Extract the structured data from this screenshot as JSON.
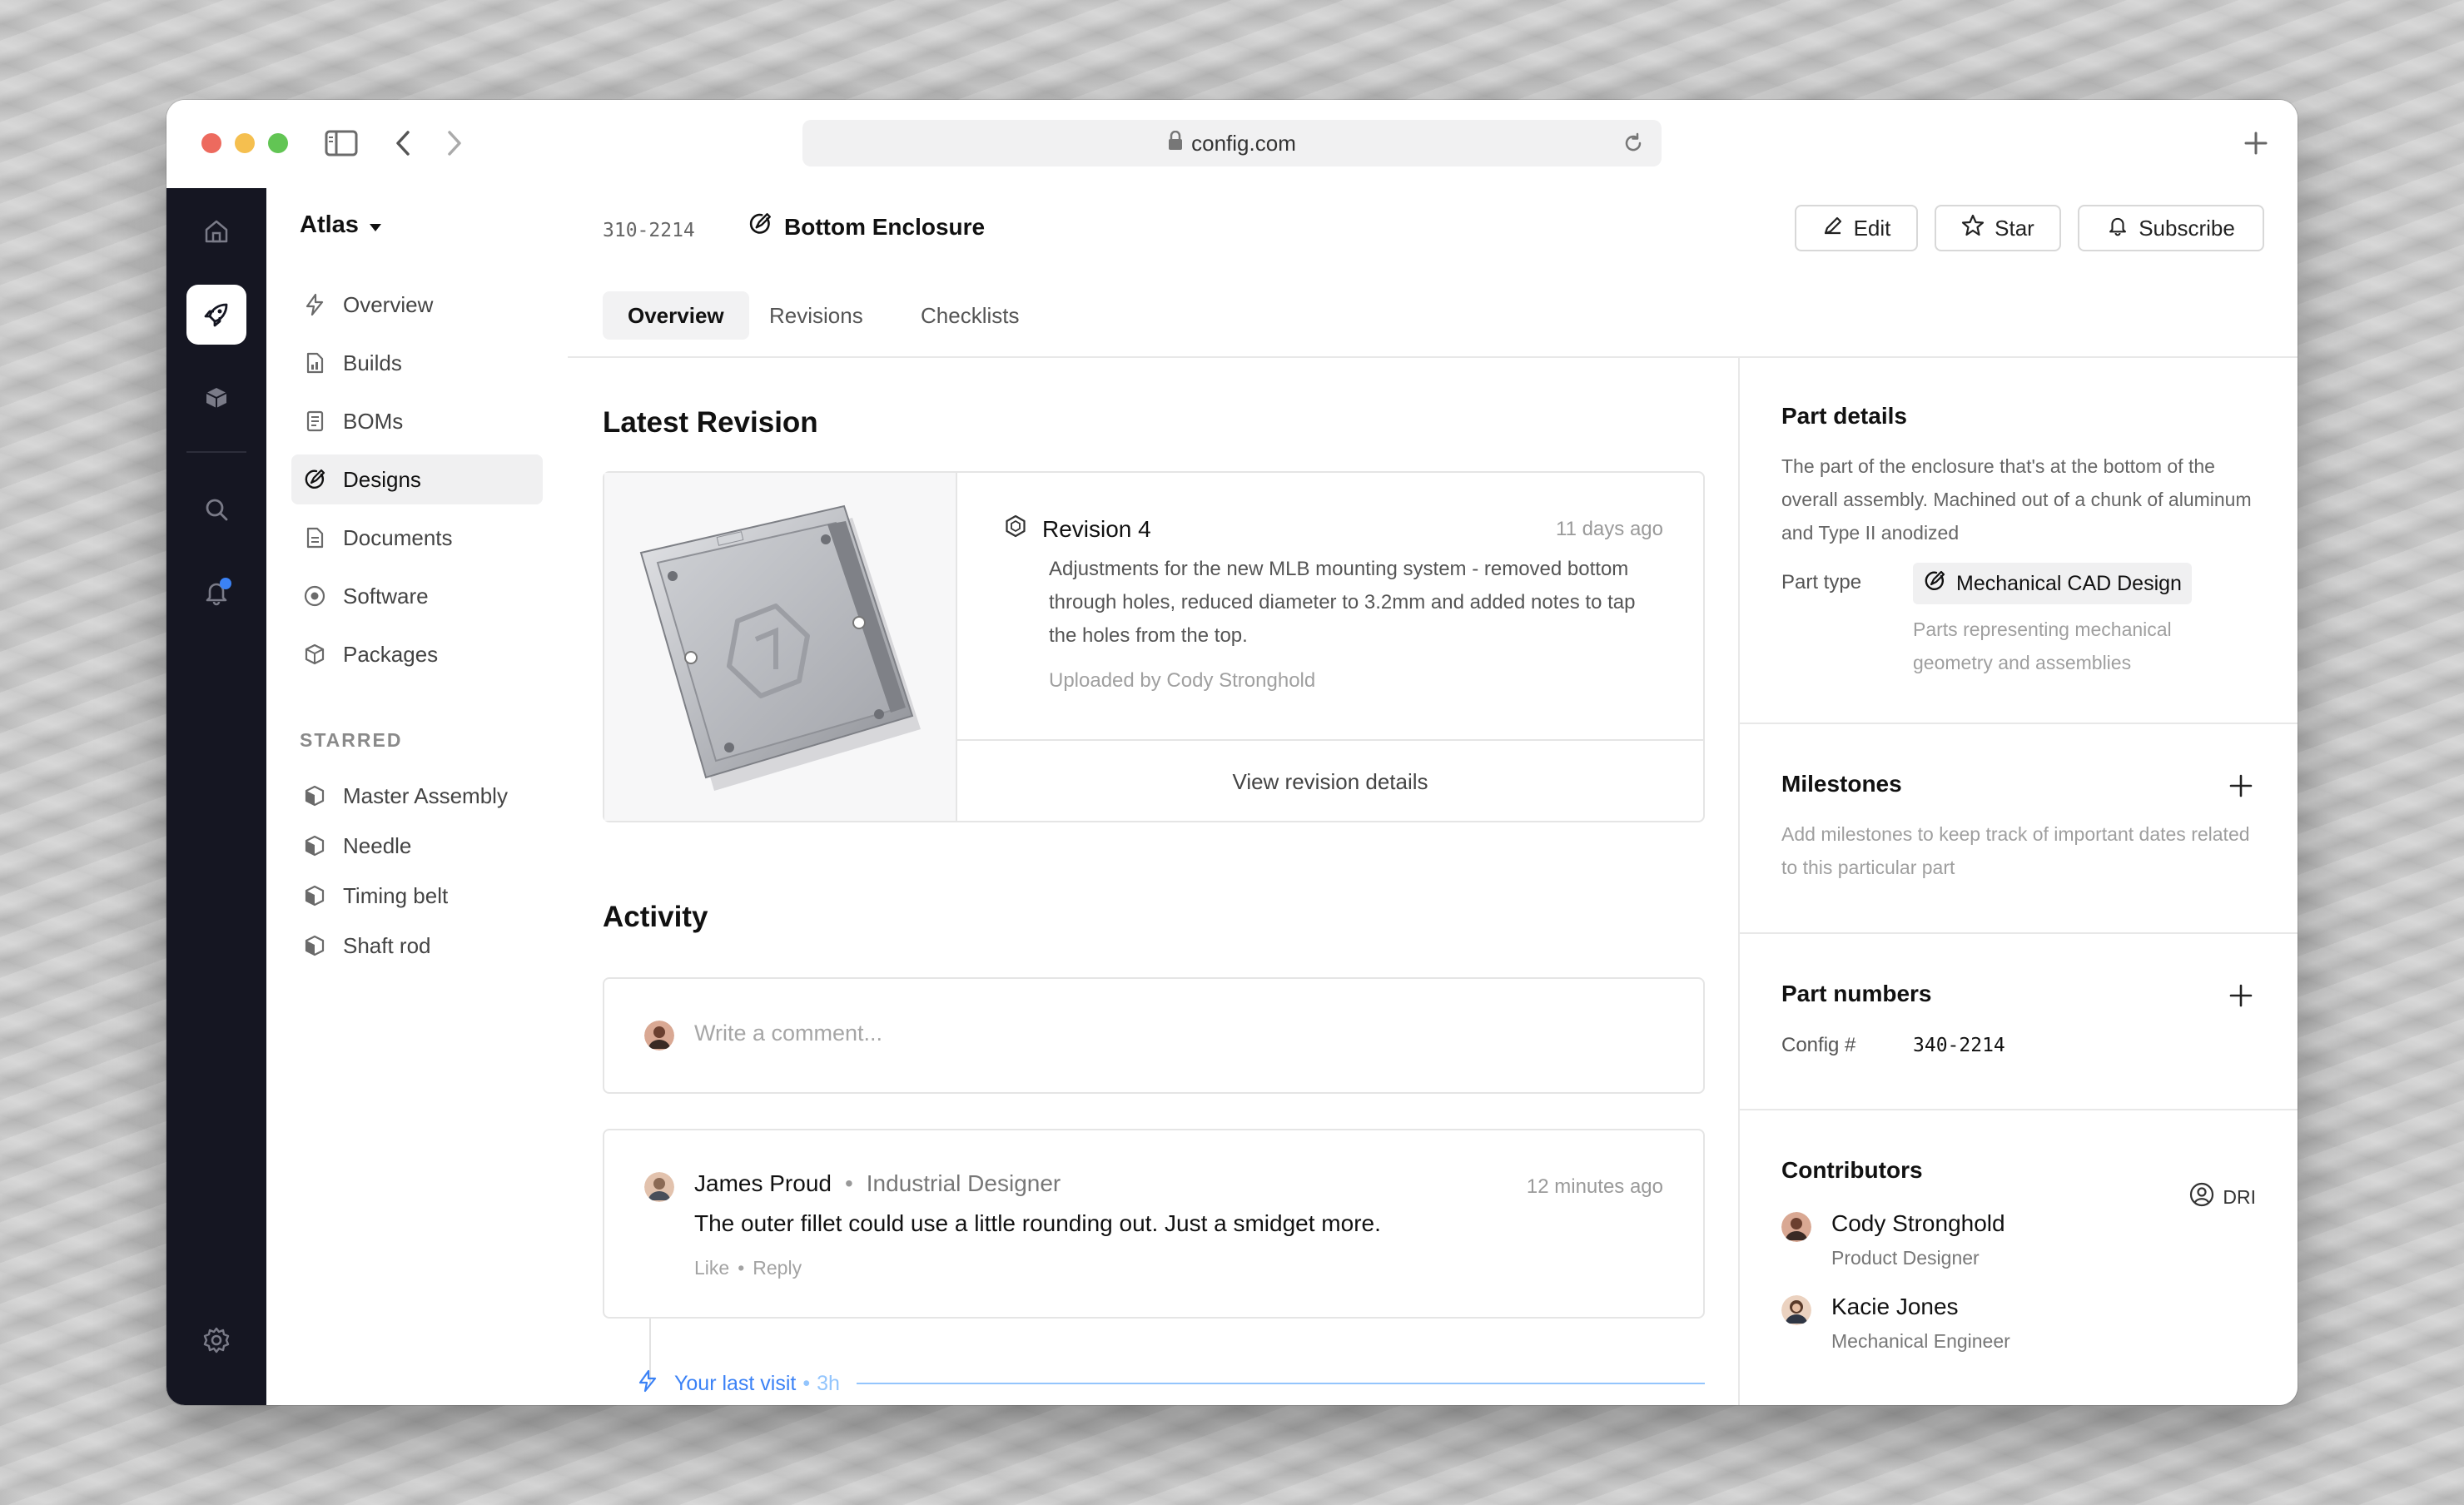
{
  "browser": {
    "url": "config.com"
  },
  "workspace": {
    "name": "Atlas"
  },
  "nav": {
    "items": [
      {
        "label": "Overview",
        "icon": "bolt-icon"
      },
      {
        "label": "Builds",
        "icon": "builds-icon"
      },
      {
        "label": "BOMs",
        "icon": "bom-icon"
      },
      {
        "label": "Designs",
        "icon": "design-icon",
        "active": true
      },
      {
        "label": "Documents",
        "icon": "document-icon"
      },
      {
        "label": "Software",
        "icon": "software-icon"
      },
      {
        "label": "Packages",
        "icon": "package-icon"
      }
    ],
    "starred_label": "STARRED",
    "starred": [
      {
        "label": "Master Assembly"
      },
      {
        "label": "Needle"
      },
      {
        "label": "Timing belt"
      },
      {
        "label": "Shaft rod"
      }
    ]
  },
  "header": {
    "part_number": "310-2214",
    "title": "Bottom Enclosure",
    "edit_label": "Edit",
    "star_label": "Star",
    "subscribe_label": "Subscribe"
  },
  "tabs": [
    {
      "label": "Overview",
      "active": true
    },
    {
      "label": "Revisions"
    },
    {
      "label": "Checklists"
    }
  ],
  "latest_revision": {
    "heading": "Latest Revision",
    "title": "Revision 4",
    "time": "11 days ago",
    "description": "Adjustments for the new MLB mounting system - removed bottom through holes, reduced diameter to 3.2mm and added notes to tap the holes from the top.",
    "uploaded_by": "Uploaded by Cody Stronghold",
    "view_label": "View revision details"
  },
  "activity": {
    "heading": "Activity",
    "comment_placeholder": "Write a comment...",
    "post": {
      "author": "James Proud",
      "role": "Industrial Designer",
      "time": "12  minutes ago",
      "text": "The outer fillet could use a little rounding out. Just a smidget more.",
      "like_label": "Like",
      "reply_label": "Reply"
    },
    "last_visit_label": "Your last visit",
    "last_visit_time": "3h"
  },
  "part_details": {
    "heading": "Part details",
    "description": "The part of the enclosure that's at the bottom of the overall assembly. Machined out of a chunk of aluminum and Type II anodized",
    "type_label": "Part type",
    "type_value": "Mechanical CAD Design",
    "type_hint": "Parts representing mechanical geometry and assemblies"
  },
  "milestones": {
    "heading": "Milestones",
    "hint": "Add milestones to keep track of important dates related to this particular part"
  },
  "part_numbers": {
    "heading": "Part numbers",
    "label": "Config #",
    "value": "340-2214"
  },
  "contributors": {
    "heading": "Contributors",
    "people": [
      {
        "name": "Cody Stronghold",
        "role": "Product Designer",
        "tag": "DRI"
      },
      {
        "name": "Kacie Jones",
        "role": "Mechanical Engineer"
      }
    ]
  },
  "colors": {
    "accent": "#3b82f6",
    "rail": "#151622"
  }
}
